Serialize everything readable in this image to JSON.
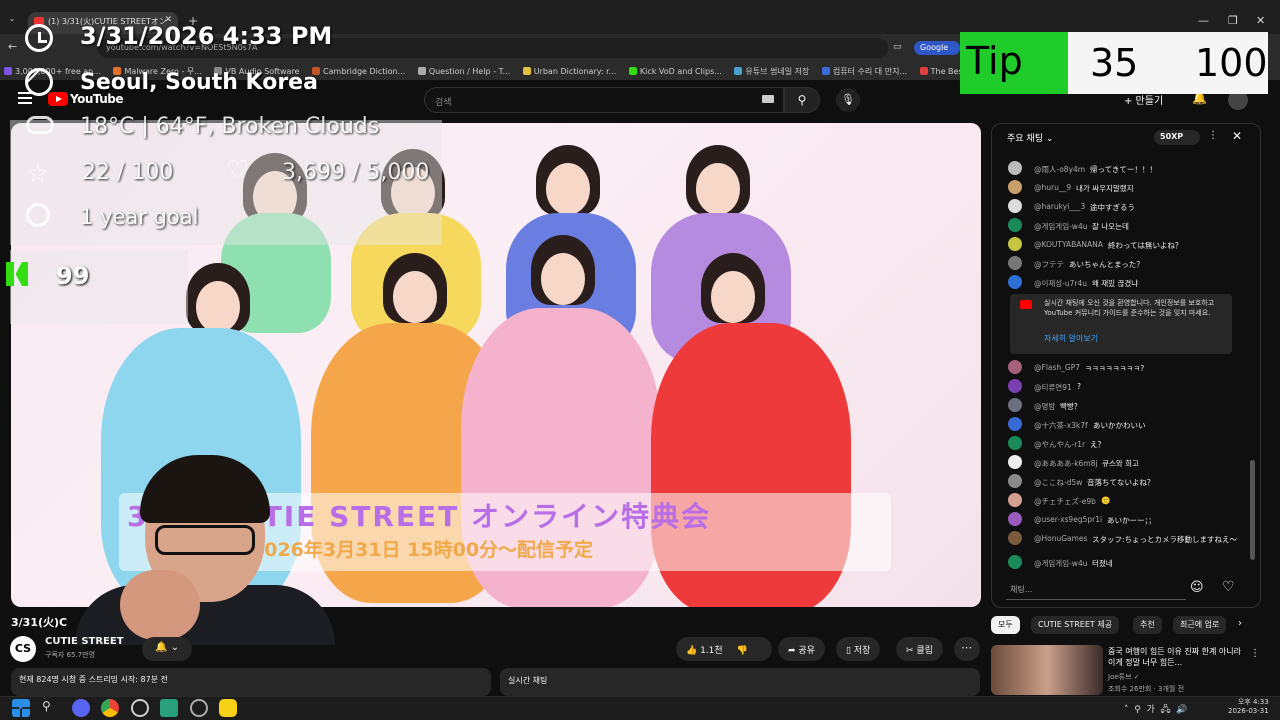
{
  "browser": {
    "tab_title": "(1) 3/31(火)CUTIE STREETオン",
    "new_tab": "+",
    "url": "youtube.com/watch?v=NOESt5N0s7A",
    "google_btn": "Google",
    "bookmarks": [
      "3,000,000+ free an...",
      "Malware Zero - 무...",
      "VB Audio Software",
      "Cambridge Diction...",
      "Question / Help - T...",
      "Urban Dictionary: r...",
      "Kick VoD and Clips...",
      "유튜브 썸네일 저장",
      "컴퓨터 수리 대 만지...",
      "The Best"
    ],
    "window_controls": [
      "—",
      "❐",
      "✕"
    ]
  },
  "overlay": {
    "datetime": "3/31/2026 4:33 PM",
    "city": "Seoul, South Korea",
    "weather": "18°C | 64°F, Broken Clouds",
    "subs": "22 / 100",
    "likes": "3,699 / 5,000",
    "goal": "1 year goal",
    "kick_count": "99",
    "tip_label": "Tip",
    "tip_current": "35",
    "tip_max": "100",
    "tip_progress": 0.35
  },
  "youtube": {
    "logo_text": "YouTube",
    "search_placeholder": "검색",
    "create_label": "+ 만들기",
    "video_banner_title": "3/31 CUTIE STREET オンライン特典会",
    "video_banner_date": "2026年3月31日 15時00分〜配信予定",
    "video_title": "3/31(火)C",
    "channel_name": "CUTIE STREET",
    "channel_subs": "구독자 65.7만명",
    "channel_avatar": "CS",
    "like_count": "1.1천",
    "share": "공유",
    "save": "저장",
    "clip": "클립",
    "viewers": "현재 824명 시청 중 스트리밍 시작: 87분 전",
    "live_chat_btn": "실시간 채팅"
  },
  "chat": {
    "header": "주요 채팅 ⌄",
    "xp": "50XP",
    "messages": [
      {
        "author": "@雨人-o8y4m",
        "text": "帰ってきてー！！！",
        "color": "#bbb"
      },
      {
        "author": "@huru__9",
        "text": "내가 싸우지말랬지",
        "color": "#c9a06a"
      },
      {
        "author": "@harukyi___3",
        "text": "途中すぎるう",
        "color": "#ddd"
      },
      {
        "author": "@게임게임-w4u",
        "text": "잘 나오는데",
        "color": "#1a8a5a"
      },
      {
        "author": "@KOUTYABANANA",
        "text": "終わっては無いよね？",
        "color": "#c6c640"
      },
      {
        "author": "@フテテ",
        "text": "あいちゃんとまった？",
        "color": "#777"
      },
      {
        "author": "@이재성-u7r4u",
        "text": "왜 재밌 끊겼냐",
        "color": "#2d6fd6"
      },
      {
        "author": "@Flash_GP7",
        "text": "ㅋㅋㅋㅋㅋㅋㅋㅋ?",
        "color": "#a6607a"
      },
      {
        "author": "@티류연91",
        "text": "?",
        "color": "#7a3fb0"
      },
      {
        "author": "@명밤",
        "text": "빡빵?",
        "color": "#6a7080"
      },
      {
        "author": "@十六茶-x3k7f",
        "text": "あいかかわいい",
        "color": "#3a6ad6"
      },
      {
        "author": "@やんやん-r1r",
        "text": "え？",
        "color": "#1a8a5a"
      },
      {
        "author": "@ああああ-k6m8j",
        "text": "큐스와 희고",
        "color": "#eee"
      },
      {
        "author": "@ここね-d5w",
        "text": "音落ちてないよね？",
        "color": "#8a8a8a"
      },
      {
        "author": "@チェチェズ-e9b",
        "text": "🙂",
        "color": "#d6a090"
      },
      {
        "author": "@user-xs9eg5pr1i",
        "text": "あいかーー；；",
        "color": "#9a5ac0"
      },
      {
        "author": "@HonuGames",
        "text": "スタッフ:ちょっとカメラ移動しますねえ〜",
        "color": "#7a5a3a"
      },
      {
        "author": "@게임게임-w4u",
        "text": "터졌네",
        "color": "#1a8a5a"
      }
    ],
    "notice_text": "실시간 채팅에 오신 것을 환영합니다. 개인정보를 보호하고 YouTube 커뮤니티 가이드를 준수하는 것을 잊지 마세요.",
    "notice_link": "자세히 알아보기",
    "input_placeholder": "채팅..."
  },
  "recommendations": {
    "chips": [
      "모두",
      "CUTIE STREET 제공",
      "추천",
      "최근에 업로"
    ],
    "title": "중국 여행이 힘든 이유 진짜 한계 아니라 이게 정말 너무 힘든...",
    "channel": "Joe튜브 ✓",
    "meta": "조회수 26만회 · 3개월 전"
  },
  "taskbar": {
    "time": "오후 4:33",
    "date": "2026-03-31",
    "ime": "가"
  },
  "colors": {
    "accent_red": "#ff0000",
    "tip_green": "#1fcc2a",
    "kick_green": "#33dd11",
    "link_blue": "#3ea6ff"
  }
}
